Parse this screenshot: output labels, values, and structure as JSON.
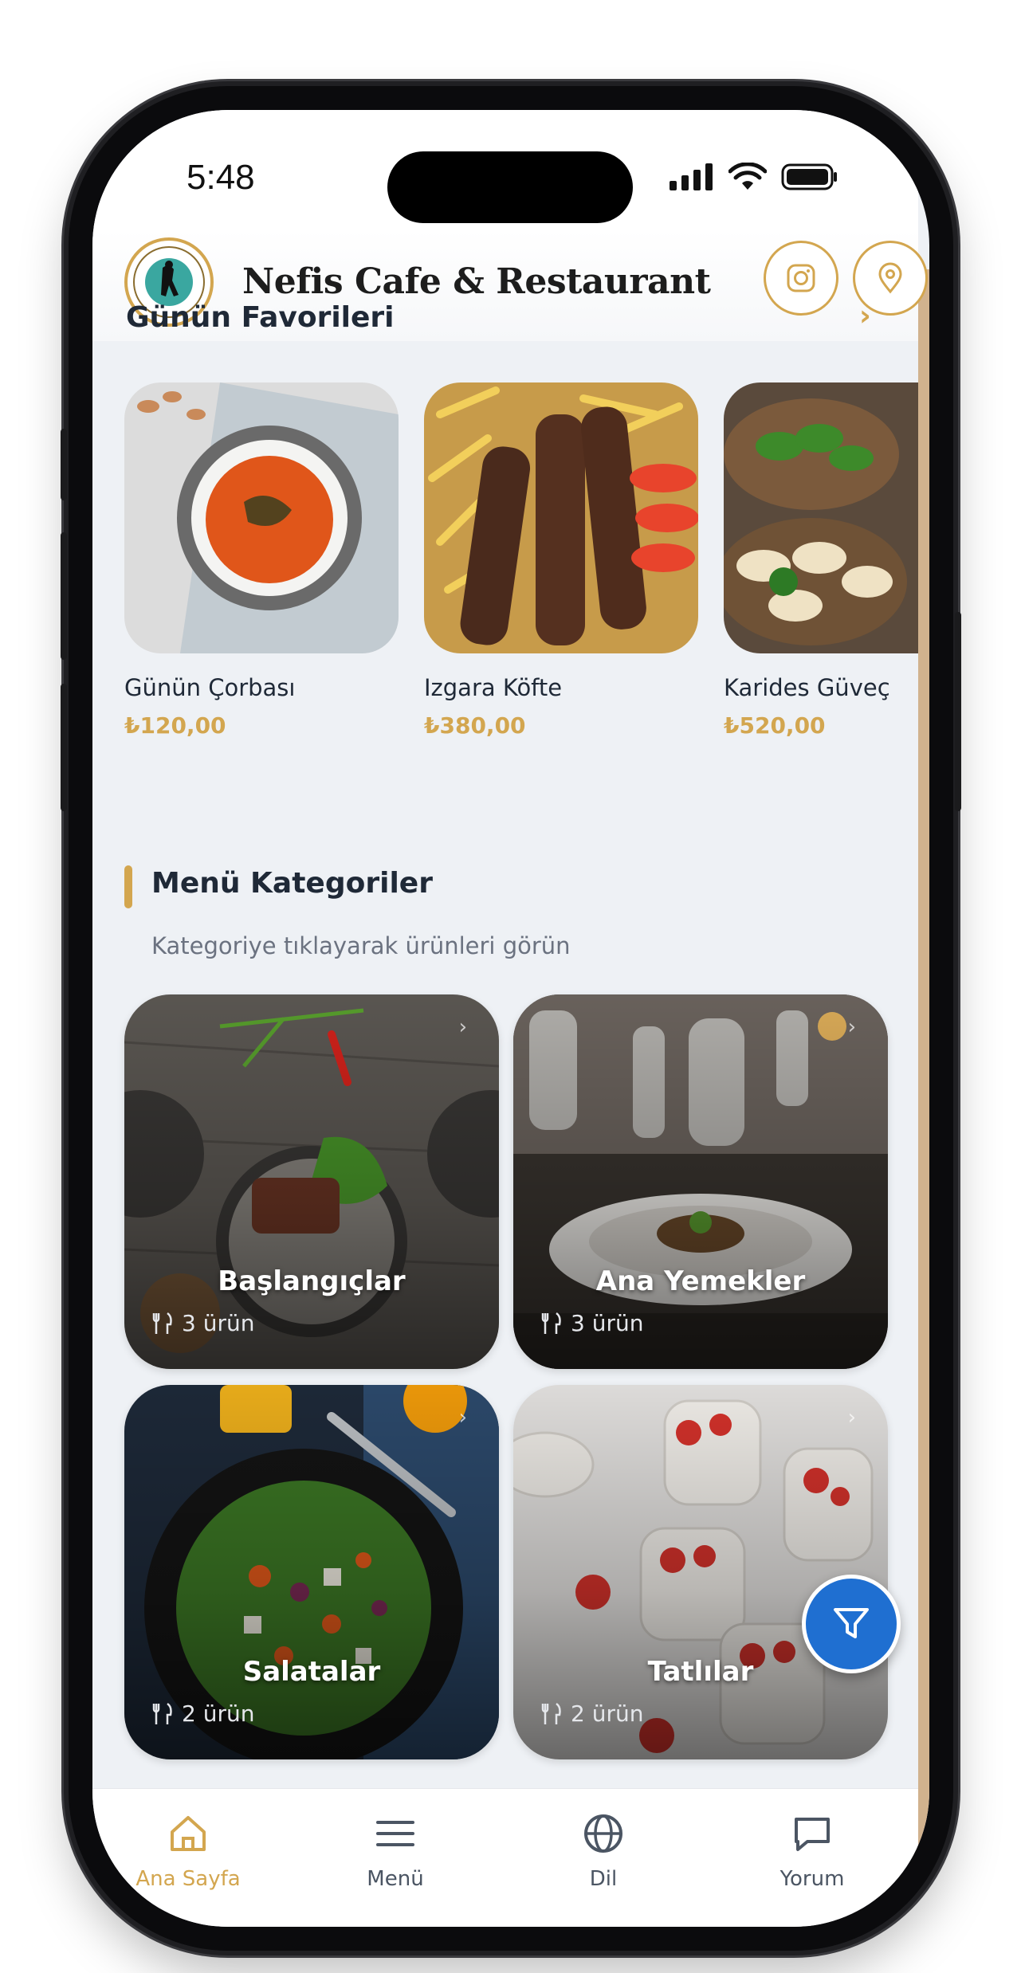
{
  "status_bar": {
    "time": "5:48"
  },
  "header": {
    "restaurant_name": "Nefis Cafe & Restaurant",
    "instagram_icon": "instagram-icon",
    "location_icon": "location-pin-icon",
    "accent_color": "#d3a64f"
  },
  "favorites": {
    "title": "Günün Favorileri",
    "items": [
      {
        "name": "Günün Çorbası",
        "price": "₺120,00",
        "image": "tomato-soup"
      },
      {
        "name": "Izgara Köfte",
        "price": "₺380,00",
        "image": "grilled-kofte"
      },
      {
        "name": "Karides Güveç",
        "price": "₺520,00",
        "image": "dumplings"
      }
    ]
  },
  "categories": {
    "title": "Menü Kategoriler",
    "subtitle": "Kategoriye tıklayarak ürünleri görün",
    "items": [
      {
        "name": "Başlangıçlar",
        "count": "3 ürün"
      },
      {
        "name": "Ana Yemekler",
        "count": "3 ürün"
      },
      {
        "name": "Salatalar",
        "count": "2 ürün"
      },
      {
        "name": "Tatlılar",
        "count": "2 ürün"
      }
    ]
  },
  "fab": {
    "icon": "filter-icon",
    "color": "#1f6fd1"
  },
  "bottom_nav": {
    "items": [
      {
        "label": "Ana Sayfa",
        "icon": "home-icon",
        "active": true
      },
      {
        "label": "Menü",
        "icon": "menu-icon",
        "active": false
      },
      {
        "label": "Dil",
        "icon": "globe-icon",
        "active": false
      },
      {
        "label": "Yorum",
        "icon": "chat-icon",
        "active": false
      }
    ]
  }
}
